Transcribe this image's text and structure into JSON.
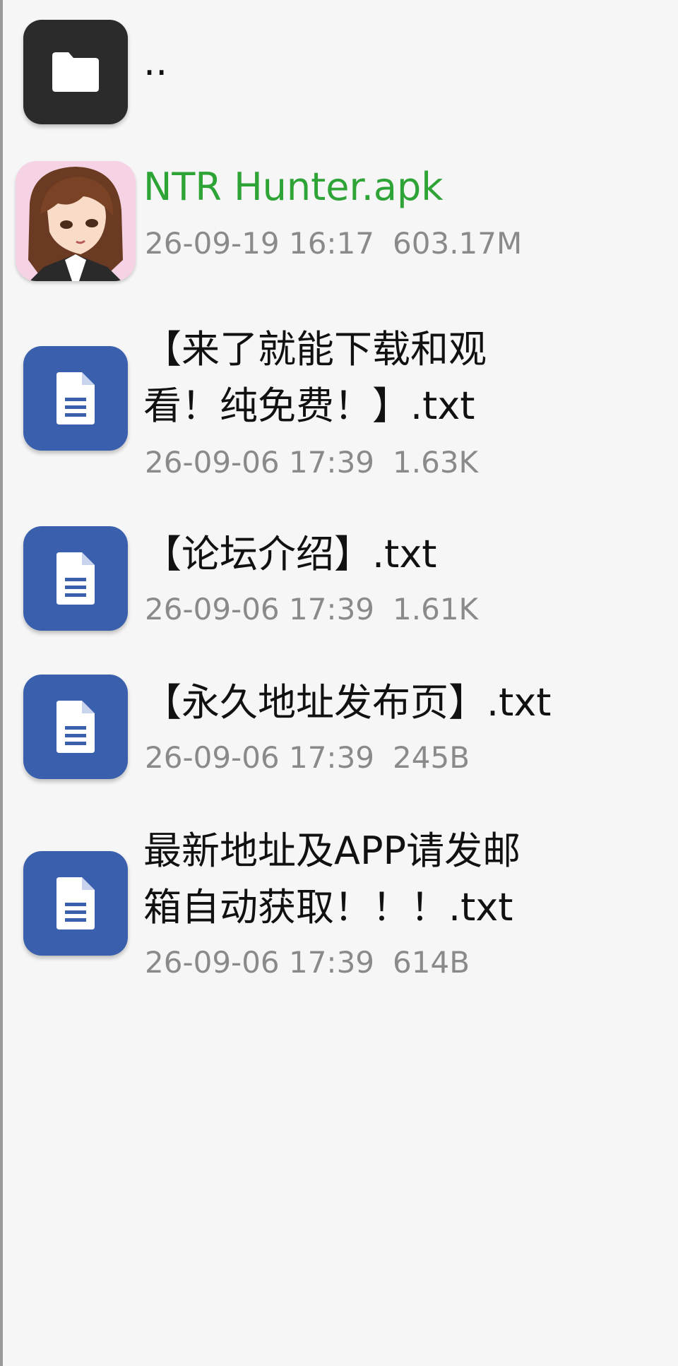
{
  "colors": {
    "background": "#f6f6f6",
    "folder_icon_bg": "#2b2b2b",
    "doc_icon_bg": "#3a5fad",
    "apk_title": "#2ea336",
    "meta_text": "#8a8a8a"
  },
  "parent": {
    "name": "..",
    "icon": "folder-icon"
  },
  "files": [
    {
      "name": "NTR Hunter.apk",
      "date": "26-09-19 16:17",
      "size": "603.17M",
      "icon": "app-avatar-icon"
    },
    {
      "name_line1": "【来了就能下载和观",
      "name_line2": "看！纯免费！】.txt",
      "date": "26-09-06 17:39",
      "size": "1.63K",
      "icon": "document-icon"
    },
    {
      "name": "【论坛介绍】.txt",
      "date": "26-09-06 17:39",
      "size": "1.61K",
      "icon": "document-icon"
    },
    {
      "name": "【永久地址发布页】.txt",
      "date": "26-09-06 17:39",
      "size": "245B",
      "icon": "document-icon"
    },
    {
      "name_line1": "最新地址及APP请发邮",
      "name_line2": "箱自动获取！！！.txt",
      "date": "26-09-06 17:39",
      "size": "614B",
      "icon": "document-icon"
    }
  ]
}
